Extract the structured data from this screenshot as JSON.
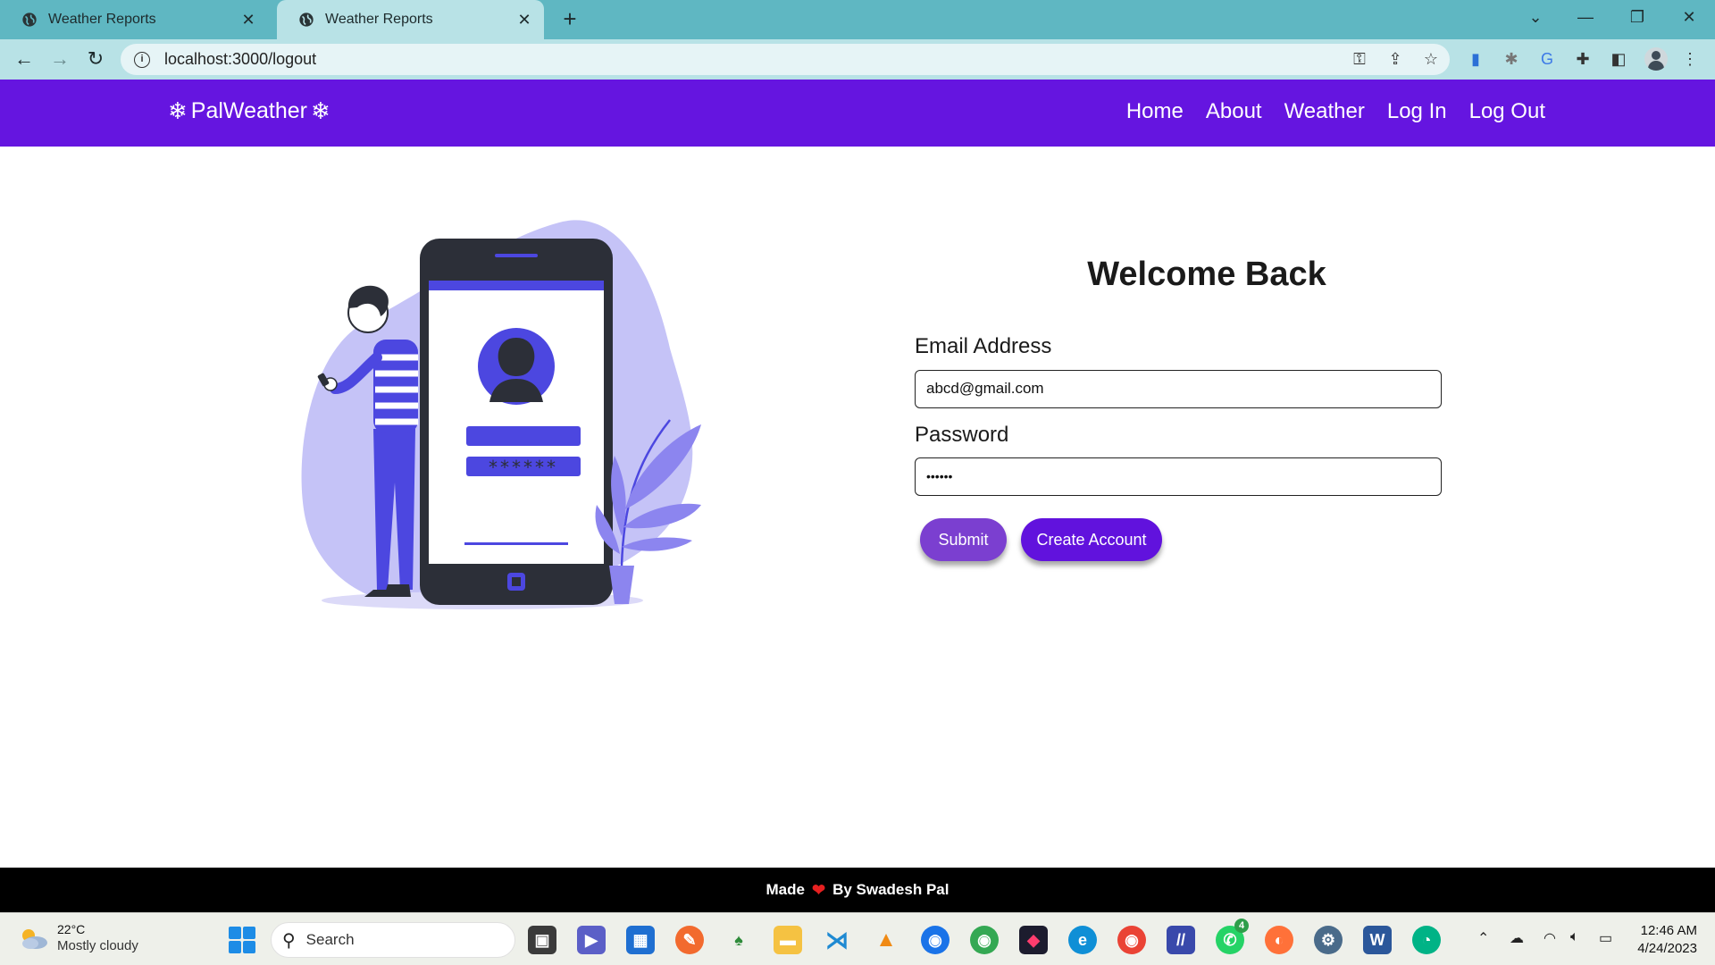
{
  "browser": {
    "tabs": [
      {
        "title": "Weather Reports",
        "active": false
      },
      {
        "title": "Weather Reports",
        "active": true
      }
    ],
    "url": "localhost:3000/logout",
    "theme_color": "#5fb7c2",
    "toolbar_color": "#b8e2e6"
  },
  "site": {
    "brand": "PalWeather",
    "nav": [
      "Home",
      "About",
      "Weather",
      "Log In",
      "Log Out"
    ],
    "accent": "#6515e0"
  },
  "login": {
    "heading": "Welcome Back",
    "email_label": "Email Address",
    "email_value": "abcd@gmail.com",
    "password_label": "Password",
    "password_value": "••••••",
    "submit_label": "Submit",
    "create_label": "Create Account",
    "illustration_password": "******"
  },
  "footer": {
    "made": "Made",
    "by": "By Swadesh Pal"
  },
  "taskbar": {
    "weather_temp": "22°C",
    "weather_condition": "Mostly cloudy",
    "search_label": "Search",
    "whatsapp_badge": "4",
    "time": "12:46 AM",
    "date": "4/24/2023"
  }
}
